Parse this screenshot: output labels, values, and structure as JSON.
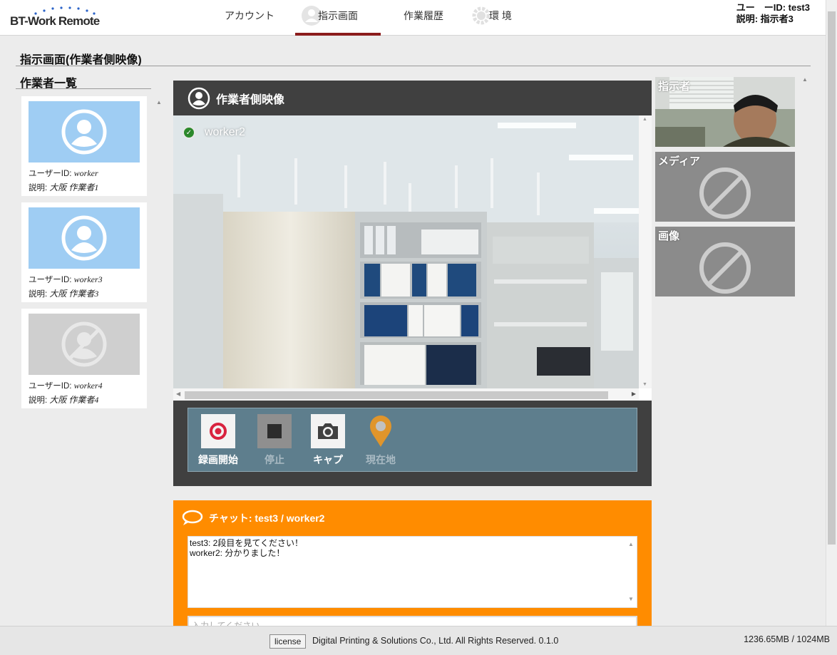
{
  "app": {
    "logo_text": "BT-Work Remote"
  },
  "nav": {
    "items": [
      {
        "label": "アカウント"
      },
      {
        "label": "指示画面"
      },
      {
        "label": "作業履歴"
      },
      {
        "label": "環 境"
      }
    ]
  },
  "user": {
    "id_line": "ユー　ーID: test3",
    "desc_line": "説明: 指示者3"
  },
  "page": {
    "title": "指示画面(作業者側映像)"
  },
  "worker_list": {
    "title": "作業者一覧",
    "workers": [
      {
        "id_label": "ユーザーID:",
        "id": "worker",
        "desc_label": "説明:",
        "desc": "大阪 作業者1",
        "status": "online"
      },
      {
        "id_label": "ユーザーID:",
        "id": "worker3",
        "desc_label": "説明:",
        "desc": "大阪 作業者3",
        "status": "online"
      },
      {
        "id_label": "ユーザーID:",
        "id": "worker4",
        "desc_label": "説明:",
        "desc": "大阪 作業者4",
        "status": "offline"
      }
    ]
  },
  "video": {
    "title": "作業者側映像",
    "worker_name": "worker2",
    "controls": {
      "record": "録画開始",
      "stop": "停止",
      "capture": "キャプ",
      "location": "現在地"
    }
  },
  "chat": {
    "title": "チャット: test3 / worker2",
    "messages": [
      "test3: 2段目を見てください！",
      "worker2: 分かりました！"
    ],
    "input_placeholder": "入力してください"
  },
  "right_panel": {
    "instructor_label": "指示者",
    "media_label": "メディア",
    "image_label": "画像"
  },
  "footer": {
    "license_label": "license",
    "copyright": "Digital Printing & Solutions Co., Ltd. All Rights Reserved. 0.1.0",
    "memory": "1236.65MB / 1024MB"
  },
  "colors": {
    "nav_active": "#8b1c1c",
    "chat_bg": "#ff8c00",
    "video_panel_bg": "#404040",
    "control_bar_bg": "#5e7e8d",
    "online_thumb": "#9fcdf3",
    "offline_thumb": "#cfcfcf"
  }
}
